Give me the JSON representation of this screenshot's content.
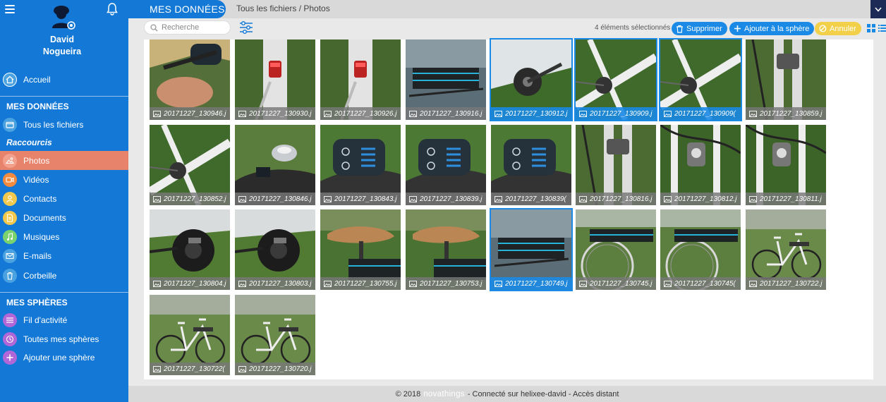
{
  "app": {
    "section_tab": "MES DONNÉES",
    "breadcrumb": "Tous les fichiers / Photos"
  },
  "user": {
    "first_name": "David",
    "last_name": "Nogueira"
  },
  "sidebar": {
    "home_label": "Accueil",
    "data_title": "MES DONNÉES",
    "all_files_label": "Tous les fichiers",
    "shortcuts_title": "Raccourcis",
    "items": [
      {
        "id": "photos",
        "label": "Photos",
        "icon": "photo-icon",
        "color": "#f3a08c",
        "active": true
      },
      {
        "id": "videos",
        "label": "Vidéos",
        "icon": "video-icon",
        "color": "#f28b3f",
        "active": false
      },
      {
        "id": "contacts",
        "label": "Contacts",
        "icon": "contact-icon",
        "color": "#f2c94c",
        "active": false
      },
      {
        "id": "documents",
        "label": "Documents",
        "icon": "document-icon",
        "color": "#f2c94c",
        "active": false
      },
      {
        "id": "musiques",
        "label": "Musiques",
        "icon": "music-icon",
        "color": "#7bd36d",
        "active": false
      },
      {
        "id": "emails",
        "label": "E-mails",
        "icon": "mail-icon",
        "color": "#4aa3e0",
        "active": false
      },
      {
        "id": "corbeille",
        "label": "Corbeille",
        "icon": "trash-icon",
        "color": "#4aa3e0",
        "active": false
      }
    ],
    "spheres_title": "MES SPHÈRES",
    "sphere_items": [
      {
        "id": "feed",
        "label": "Fil d'activité",
        "icon": "list-icon",
        "color": "#b267d8"
      },
      {
        "id": "all-spheres",
        "label": "Toutes mes sphères",
        "icon": "sphere-icon",
        "color": "#b267d8"
      },
      {
        "id": "add-sphere",
        "label": "Ajouter une sphère",
        "icon": "plus-icon",
        "color": "#b267d8"
      }
    ]
  },
  "toolbar": {
    "search_placeholder": "Recherche",
    "selected_count": "4 éléments sélectionnés",
    "delete_label": "Supprimer",
    "add_to_sphere_label": "Ajouter à la sphère",
    "cancel_label": "Annuler"
  },
  "photos": [
    {
      "name": "20171227_130946.j",
      "selected": false,
      "scene": "hand-display"
    },
    {
      "name": "20171227_130930.j",
      "selected": false,
      "scene": "rear-light"
    },
    {
      "name": "20171227_130926.j",
      "selected": false,
      "scene": "rear-light"
    },
    {
      "name": "20171227_130916.j",
      "selected": false,
      "scene": "battery-rack"
    },
    {
      "name": "20171227_130912.j",
      "selected": true,
      "scene": "crank"
    },
    {
      "name": "20171227_130909.j",
      "selected": true,
      "scene": "frame"
    },
    {
      "name": "20171227_130909(",
      "selected": true,
      "scene": "frame"
    },
    {
      "name": "20171227_130859.j",
      "selected": false,
      "scene": "fork"
    },
    {
      "name": "20171227_130852.j",
      "selected": false,
      "scene": "frame"
    },
    {
      "name": "20171227_130846.j",
      "selected": false,
      "scene": "bell"
    },
    {
      "name": "20171227_130843.j",
      "selected": false,
      "scene": "display"
    },
    {
      "name": "20171227_130839.j",
      "selected": false,
      "scene": "display"
    },
    {
      "name": "20171227_130839(",
      "selected": false,
      "scene": "display"
    },
    {
      "name": "20171227_130816.j",
      "selected": false,
      "scene": "fork"
    },
    {
      "name": "20171227_130812.j",
      "selected": false,
      "scene": "headlight"
    },
    {
      "name": "20171227_130811.j",
      "selected": false,
      "scene": "headlight"
    },
    {
      "name": "20171227_130804.j",
      "selected": false,
      "scene": "motor"
    },
    {
      "name": "20171227_130803.j",
      "selected": false,
      "scene": "motor"
    },
    {
      "name": "20171227_130755.j",
      "selected": false,
      "scene": "saddle"
    },
    {
      "name": "20171227_130753.j",
      "selected": false,
      "scene": "saddle"
    },
    {
      "name": "20171227_130749.j",
      "selected": true,
      "scene": "battery-rack"
    },
    {
      "name": "20171227_130745.j",
      "selected": false,
      "scene": "rear-wheel"
    },
    {
      "name": "20171227_130745(",
      "selected": false,
      "scene": "rear-wheel"
    },
    {
      "name": "20171227_130722.j",
      "selected": false,
      "scene": "bike-full"
    },
    {
      "name": "20171227_130722(",
      "selected": false,
      "scene": "bike-full"
    },
    {
      "name": "20171227_130720.j",
      "selected": false,
      "scene": "bike-full"
    }
  ],
  "footer": {
    "copyright": "© 2018",
    "brand": "novathings",
    "status": "- Connecté sur helixee-david - Accès distant"
  },
  "colors": {
    "primary": "#1479d6",
    "active_item": "#e8836b",
    "button_blue": "#1a8ae6",
    "cancel_yellow": "#f2d04a",
    "header_dark": "#1c2a55"
  }
}
